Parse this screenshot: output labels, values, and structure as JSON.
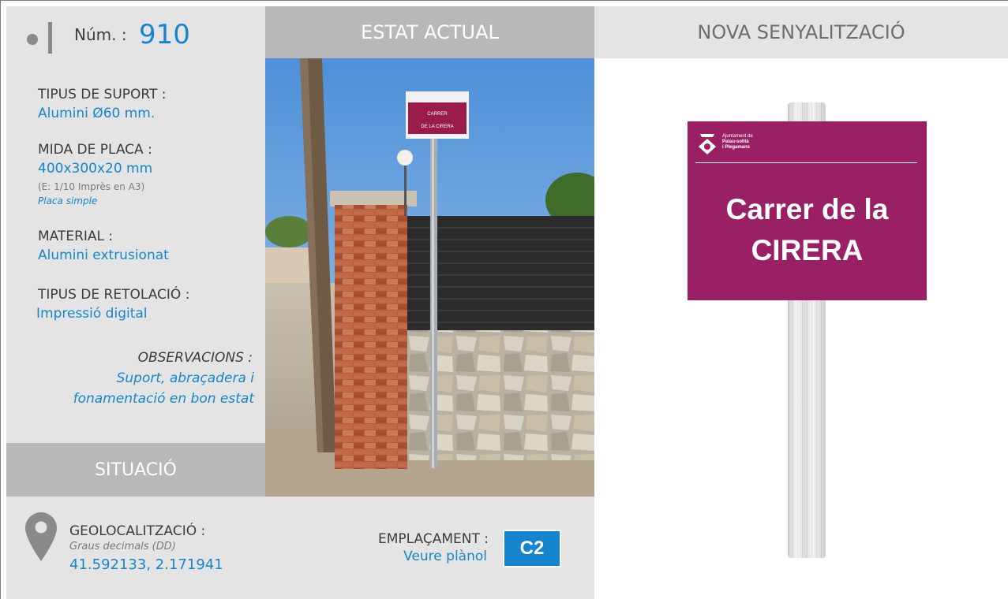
{
  "header": {
    "num_label": "Núm. :",
    "num_value": "910",
    "estat_title": "ESTAT ACTUAL",
    "nova_title": "NOVA SENYALITZACIÓ"
  },
  "info": {
    "suport_label": "TIPUS DE SUPORT :",
    "suport_value": "Alumini Ø60 mm.",
    "mida_label": "MIDA DE PLACA :",
    "mida_value": "400x300x20 mm",
    "mida_scale": "(E: 1/10 Imprès en A3)",
    "mida_type": "Placa simple",
    "material_label": "MATERIAL :",
    "material_value": "Alumini extrusionat",
    "retolacio_label": "TIPUS DE RETOLACIÓ :",
    "retolacio_value": "Impressió digital",
    "obs_label": "OBSERVACIONS :",
    "obs_line1": "Suport, abraçadera i",
    "obs_line2": "fonamentació en bon estat"
  },
  "situacio": {
    "title": "SITUACIÓ",
    "geo_label": "GEOLOCALITZACIÓ :",
    "geo_sub": "Graus decimals (DD)",
    "geo_value": "41.592133, 2.171941",
    "emp_label": "EMPLAÇAMENT :",
    "emp_value": "Veure plànol",
    "emp_code": "C2"
  },
  "photo": {
    "sign_line1": "CARRER",
    "sign_line2": "DE LA CIRERA"
  },
  "plate": {
    "org_line1": "Ajuntament de",
    "org_line2": "Palau-solità",
    "org_line3": "i Plegamans",
    "text_line1": "Carrer de la",
    "text_line2": "CIRERA"
  },
  "colors": {
    "accent_blue": "#1585d0",
    "plate_purple": "#9a2066",
    "panel_gray": "#e4e4e4",
    "header_gray": "#b8b8b8"
  }
}
